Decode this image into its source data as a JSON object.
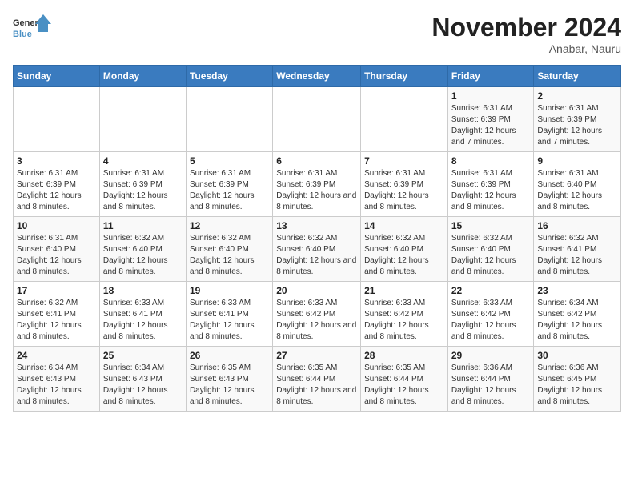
{
  "logo": {
    "line1": "General",
    "line2": "Blue"
  },
  "title": "November 2024",
  "location": "Anabar, Nauru",
  "days_of_week": [
    "Sunday",
    "Monday",
    "Tuesday",
    "Wednesday",
    "Thursday",
    "Friday",
    "Saturday"
  ],
  "weeks": [
    [
      {
        "day": "",
        "info": ""
      },
      {
        "day": "",
        "info": ""
      },
      {
        "day": "",
        "info": ""
      },
      {
        "day": "",
        "info": ""
      },
      {
        "day": "",
        "info": ""
      },
      {
        "day": "1",
        "info": "Sunrise: 6:31 AM\nSunset: 6:39 PM\nDaylight: 12 hours and 7 minutes."
      },
      {
        "day": "2",
        "info": "Sunrise: 6:31 AM\nSunset: 6:39 PM\nDaylight: 12 hours and 7 minutes."
      }
    ],
    [
      {
        "day": "3",
        "info": "Sunrise: 6:31 AM\nSunset: 6:39 PM\nDaylight: 12 hours and 8 minutes."
      },
      {
        "day": "4",
        "info": "Sunrise: 6:31 AM\nSunset: 6:39 PM\nDaylight: 12 hours and 8 minutes."
      },
      {
        "day": "5",
        "info": "Sunrise: 6:31 AM\nSunset: 6:39 PM\nDaylight: 12 hours and 8 minutes."
      },
      {
        "day": "6",
        "info": "Sunrise: 6:31 AM\nSunset: 6:39 PM\nDaylight: 12 hours and 8 minutes."
      },
      {
        "day": "7",
        "info": "Sunrise: 6:31 AM\nSunset: 6:39 PM\nDaylight: 12 hours and 8 minutes."
      },
      {
        "day": "8",
        "info": "Sunrise: 6:31 AM\nSunset: 6:39 PM\nDaylight: 12 hours and 8 minutes."
      },
      {
        "day": "9",
        "info": "Sunrise: 6:31 AM\nSunset: 6:40 PM\nDaylight: 12 hours and 8 minutes."
      }
    ],
    [
      {
        "day": "10",
        "info": "Sunrise: 6:31 AM\nSunset: 6:40 PM\nDaylight: 12 hours and 8 minutes."
      },
      {
        "day": "11",
        "info": "Sunrise: 6:32 AM\nSunset: 6:40 PM\nDaylight: 12 hours and 8 minutes."
      },
      {
        "day": "12",
        "info": "Sunrise: 6:32 AM\nSunset: 6:40 PM\nDaylight: 12 hours and 8 minutes."
      },
      {
        "day": "13",
        "info": "Sunrise: 6:32 AM\nSunset: 6:40 PM\nDaylight: 12 hours and 8 minutes."
      },
      {
        "day": "14",
        "info": "Sunrise: 6:32 AM\nSunset: 6:40 PM\nDaylight: 12 hours and 8 minutes."
      },
      {
        "day": "15",
        "info": "Sunrise: 6:32 AM\nSunset: 6:40 PM\nDaylight: 12 hours and 8 minutes."
      },
      {
        "day": "16",
        "info": "Sunrise: 6:32 AM\nSunset: 6:41 PM\nDaylight: 12 hours and 8 minutes."
      }
    ],
    [
      {
        "day": "17",
        "info": "Sunrise: 6:32 AM\nSunset: 6:41 PM\nDaylight: 12 hours and 8 minutes."
      },
      {
        "day": "18",
        "info": "Sunrise: 6:33 AM\nSunset: 6:41 PM\nDaylight: 12 hours and 8 minutes."
      },
      {
        "day": "19",
        "info": "Sunrise: 6:33 AM\nSunset: 6:41 PM\nDaylight: 12 hours and 8 minutes."
      },
      {
        "day": "20",
        "info": "Sunrise: 6:33 AM\nSunset: 6:42 PM\nDaylight: 12 hours and 8 minutes."
      },
      {
        "day": "21",
        "info": "Sunrise: 6:33 AM\nSunset: 6:42 PM\nDaylight: 12 hours and 8 minutes."
      },
      {
        "day": "22",
        "info": "Sunrise: 6:33 AM\nSunset: 6:42 PM\nDaylight: 12 hours and 8 minutes."
      },
      {
        "day": "23",
        "info": "Sunrise: 6:34 AM\nSunset: 6:42 PM\nDaylight: 12 hours and 8 minutes."
      }
    ],
    [
      {
        "day": "24",
        "info": "Sunrise: 6:34 AM\nSunset: 6:43 PM\nDaylight: 12 hours and 8 minutes."
      },
      {
        "day": "25",
        "info": "Sunrise: 6:34 AM\nSunset: 6:43 PM\nDaylight: 12 hours and 8 minutes."
      },
      {
        "day": "26",
        "info": "Sunrise: 6:35 AM\nSunset: 6:43 PM\nDaylight: 12 hours and 8 minutes."
      },
      {
        "day": "27",
        "info": "Sunrise: 6:35 AM\nSunset: 6:44 PM\nDaylight: 12 hours and 8 minutes."
      },
      {
        "day": "28",
        "info": "Sunrise: 6:35 AM\nSunset: 6:44 PM\nDaylight: 12 hours and 8 minutes."
      },
      {
        "day": "29",
        "info": "Sunrise: 6:36 AM\nSunset: 6:44 PM\nDaylight: 12 hours and 8 minutes."
      },
      {
        "day": "30",
        "info": "Sunrise: 6:36 AM\nSunset: 6:45 PM\nDaylight: 12 hours and 8 minutes."
      }
    ]
  ]
}
